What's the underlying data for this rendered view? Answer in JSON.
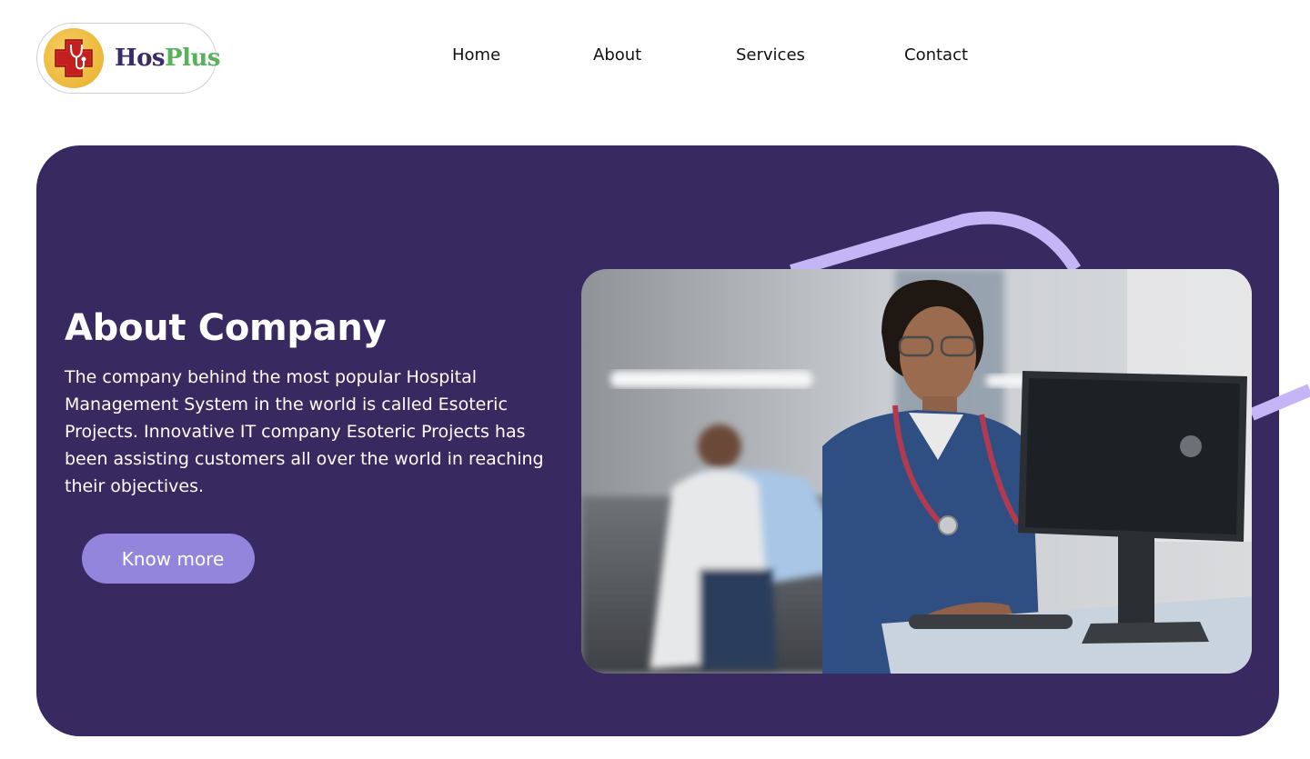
{
  "brand": {
    "name_part1": "Hos",
    "name_part2": "Plus",
    "primary_color": "#382961",
    "accent_color": "#9485dc",
    "green": "#57b25a"
  },
  "nav": {
    "items": [
      {
        "label": "Home"
      },
      {
        "label": "About"
      },
      {
        "label": "Services"
      },
      {
        "label": "Contact"
      }
    ]
  },
  "hero": {
    "title": "About Company",
    "description": "The company behind the most popular Hospital Management System in the world is called Esoteric Projects. Innovative IT company Esoteric Projects has been assisting customers all over the world in reaching their objectives.",
    "cta_label": "Know more"
  }
}
